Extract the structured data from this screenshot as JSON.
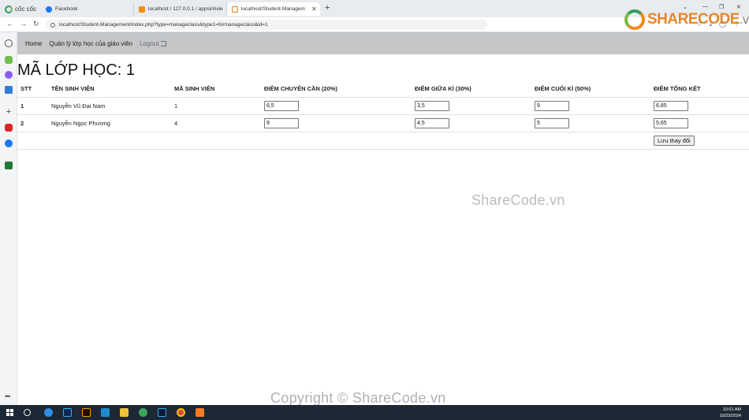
{
  "browser": {
    "brand": "cốc cốc",
    "tabs": [
      {
        "title": "Facebook",
        "icon": "facebook-icon"
      },
      {
        "title": "localhost / 127.0.0.1 / appsinhvie",
        "icon": "phpmyadmin-icon"
      },
      {
        "title": "localhost/Student-Managem",
        "icon": "page-icon",
        "active": true
      }
    ],
    "new_tab": "+",
    "address": "localhost/Student-Management/index.php?type=manageclass&type1=formanageclass&id=1"
  },
  "app_nav": {
    "home": "Home",
    "manage_classes": "Quản lý lớp học của giáo viên",
    "logout": "Logout"
  },
  "page_title": "MÃ LỚP HỌC: 1",
  "table": {
    "headers": [
      "STT",
      "TÊN SINH VIÊN",
      "MÃ SINH VIÊN",
      "ĐIỂM CHUYÊN CẦN (20%)",
      "ĐIỂM GIỮA KÌ (30%)",
      "ĐIỂM CUỐI KÌ (50%)",
      "ĐIỂM TỔNG KẾT"
    ],
    "rows": [
      {
        "stt": "1",
        "name": "Nguyễn Vũ Đại Nam",
        "student_id": "1",
        "attendance": "6,5",
        "midterm": "3,5",
        "final": "9",
        "total": "6,85"
      },
      {
        "stt": "2",
        "name": "Nguyễn Ngọc Phương",
        "student_id": "4",
        "attendance": "9",
        "midterm": "4,5",
        "final": "5",
        "total": "5,65"
      }
    ],
    "save_label": "Lưu thay đổi"
  },
  "watermarks": {
    "logo_main": "SHARECODE",
    "logo_suffix": ".vn",
    "middle": "ShareCode.vn",
    "bottom": "Copyright © ShareCode.vn"
  },
  "taskbar": {
    "time": "10:01 AM",
    "date": "10/23/2024"
  },
  "colors": {
    "app_nav_bg": "#c4c6c8",
    "watermark_orange": "#e8862a",
    "taskbar_bg": "#1c2833"
  }
}
